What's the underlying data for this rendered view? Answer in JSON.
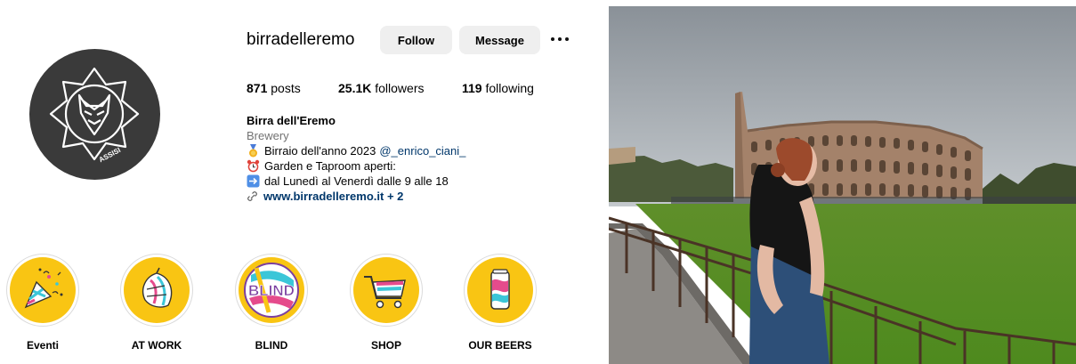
{
  "profile": {
    "username": "birradelleremo",
    "follow_label": "Follow",
    "message_label": "Message",
    "stats": {
      "posts_count": "871",
      "posts_label": " posts",
      "followers_count": "25.1K",
      "followers_label": " followers",
      "following_count": "119",
      "following_label": " following"
    },
    "bio": {
      "name": "Birra dell'Eremo",
      "category": "Brewery",
      "line1_text": "Birraio dell'anno 2023 ",
      "line1_mention": "@_enrico_ciani_",
      "line2_text": "Garden e Taproom aperti:",
      "line3_text": "dal Lunedì al Venerdì dalle 9 alle 18",
      "link_text": "www.birradelleremo.it + 2"
    },
    "avatar_text": "ASSISI",
    "highlights": [
      {
        "label": "Eventi",
        "icon": "party-popper-icon"
      },
      {
        "label": "AT WORK",
        "icon": "hop-leaf-icon"
      },
      {
        "label": "BLIND",
        "icon": "blind-logo-icon",
        "logo_text": "BLIND"
      },
      {
        "label": "SHOP",
        "icon": "shopping-cart-icon"
      },
      {
        "label": "OUR BEERS",
        "icon": "beer-can-icon"
      }
    ]
  },
  "colors": {
    "highlight_bg": "#f9c513",
    "button_bg": "#efefef",
    "link": "#00376b",
    "avatar_bg": "#3a3a3a"
  }
}
